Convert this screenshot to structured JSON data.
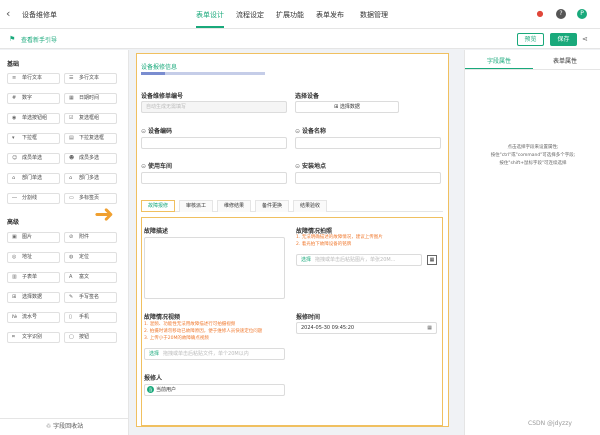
{
  "header": {
    "title": "设备维修单",
    "tabs": [
      {
        "label": "表单设计",
        "active": true
      },
      {
        "label": "流程设定",
        "active": false
      },
      {
        "label": "扩展功能",
        "active": false
      },
      {
        "label": "表单发布",
        "active": false
      },
      {
        "label": "数据管理",
        "active": false
      }
    ],
    "help_glyph": "?",
    "avatar_letter": "P"
  },
  "subheader": {
    "guide_label": "查看新手引导",
    "preview_label": "预览",
    "save_label": "保存"
  },
  "left_panel": {
    "basic_title": "基础",
    "basic_items": [
      {
        "label": "单行文本",
        "icon": "text-icon"
      },
      {
        "label": "多行文本",
        "icon": "textarea-icon"
      },
      {
        "label": "数字",
        "icon": "number-icon"
      },
      {
        "label": "日期时间",
        "icon": "calendar-icon"
      },
      {
        "label": "单选按钮组",
        "icon": "radio-icon"
      },
      {
        "label": "复选框组",
        "icon": "checkbox-icon"
      },
      {
        "label": "下拉框",
        "icon": "dropdown-icon"
      },
      {
        "label": "下拉复选框",
        "icon": "dropdown-multi-icon"
      },
      {
        "label": "成员单选",
        "icon": "user-icon"
      },
      {
        "label": "成员多选",
        "icon": "users-icon"
      },
      {
        "label": "部门单选",
        "icon": "dept-icon"
      },
      {
        "label": "部门多选",
        "icon": "dept-multi-icon"
      },
      {
        "label": "分割线",
        "icon": "divider-icon"
      },
      {
        "label": "多标签页",
        "icon": "tabs-icon"
      }
    ],
    "advanced_title": "高级",
    "advanced_items": [
      {
        "label": "图片",
        "icon": "image-icon"
      },
      {
        "label": "附件",
        "icon": "attachment-icon"
      },
      {
        "label": "地址",
        "icon": "address-icon"
      },
      {
        "label": "定位",
        "icon": "location-icon"
      },
      {
        "label": "子表单",
        "icon": "subform-icon"
      },
      {
        "label": "富文",
        "icon": "richtext-icon"
      },
      {
        "label": "选择数据",
        "icon": "select-data-icon"
      },
      {
        "label": "手写签名",
        "icon": "signature-icon"
      },
      {
        "label": "流水号",
        "icon": "serial-icon"
      },
      {
        "label": "手机",
        "icon": "phone-icon"
      },
      {
        "label": "文字识别",
        "icon": "ocr-icon"
      },
      {
        "label": "按钮",
        "icon": "button-icon"
      }
    ],
    "recycle_label": "字段回收站"
  },
  "canvas": {
    "section_title": "设备报修信息",
    "fields": {
      "repair_no_label": "设备维修单编号",
      "repair_no_placeholder": "自动生成无需填写",
      "select_device_label": "选择设备",
      "select_device_button": "选择数据",
      "device_code_label": "设备编码",
      "device_name_label": "设备名称",
      "workshop_label": "使用车间",
      "install_location_label": "安装地点"
    },
    "inner_tabs": [
      {
        "label": "故障报修",
        "active": true
      },
      {
        "label": "审核派工",
        "active": false
      },
      {
        "label": "维修结果",
        "active": false
      },
      {
        "label": "备件更换",
        "active": false
      },
      {
        "label": "结果验收",
        "active": false
      }
    ],
    "fault": {
      "desc_label": "故障描述",
      "photo_label": "故障情况拍照",
      "photo_hints": [
        "1. 无法明确描述的故障情况，建议上传图片",
        "2. 着光拍下故障设备的铭牌"
      ],
      "photo_upload_btn": "选择",
      "photo_upload_placeholder": "拖拽或单击后粘贴图片，单张20M...",
      "video_label": "故障情况视频",
      "video_hints": [
        "1. 混频、功能性无法用故障描述行可拍摄视频",
        "2. 拍摄时请勿移动已故障原因，便于维修人员快速定位问题",
        "3. 上传小于20M的故障确点视频"
      ],
      "video_upload_btn": "选择",
      "video_upload_placeholder": "拖拽或单击后粘贴文件，单个20M以内",
      "report_time_label": "报修时间",
      "report_time_value": "2024-05-30 09:45:20",
      "reporter_label": "报修人",
      "reporter_value": "当前用户",
      "reporter_avatar": "当"
    }
  },
  "right_panel": {
    "tabs": [
      {
        "label": "字段属性",
        "active": true
      },
      {
        "label": "表单属性",
        "active": false
      }
    ],
    "hint_lines": [
      "点击选择字段来设置属性;",
      "按住\"ctrl\"或\"command\"可选择多个字段;",
      "按住\"shift+鼠标字段\"可连续选择"
    ]
  },
  "watermark": "CSDN @jdyzzy"
}
